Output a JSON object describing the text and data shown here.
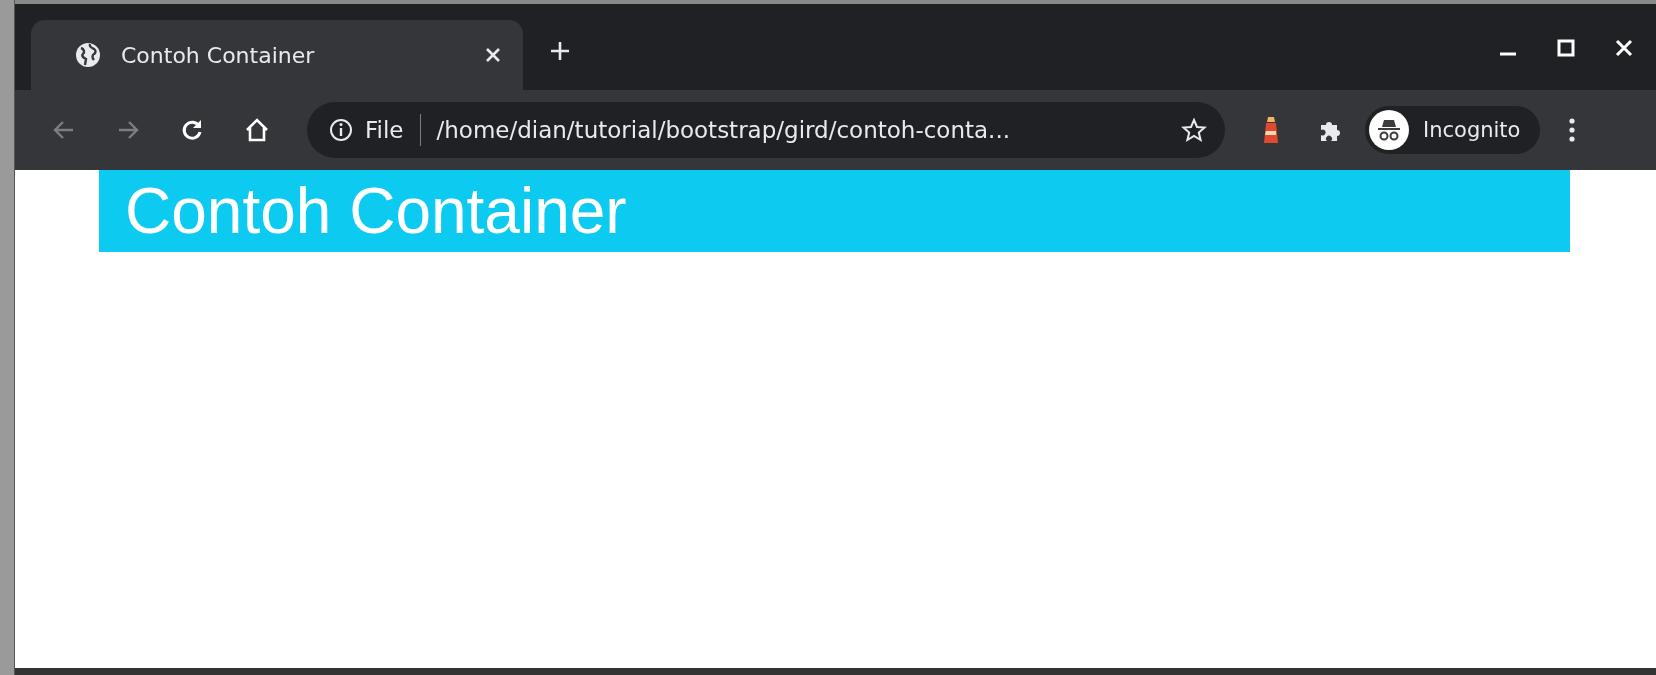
{
  "tabs": [
    {
      "title": "Contoh Container",
      "selected": true
    }
  ],
  "toolbar": {
    "back_disabled": true,
    "forward_disabled": true,
    "site_info": "File",
    "url": "/home/dian/tutorial/bootstrap/gird/contoh-conta...",
    "profile": "Incognito"
  },
  "page": {
    "heading": "Contoh Container"
  }
}
